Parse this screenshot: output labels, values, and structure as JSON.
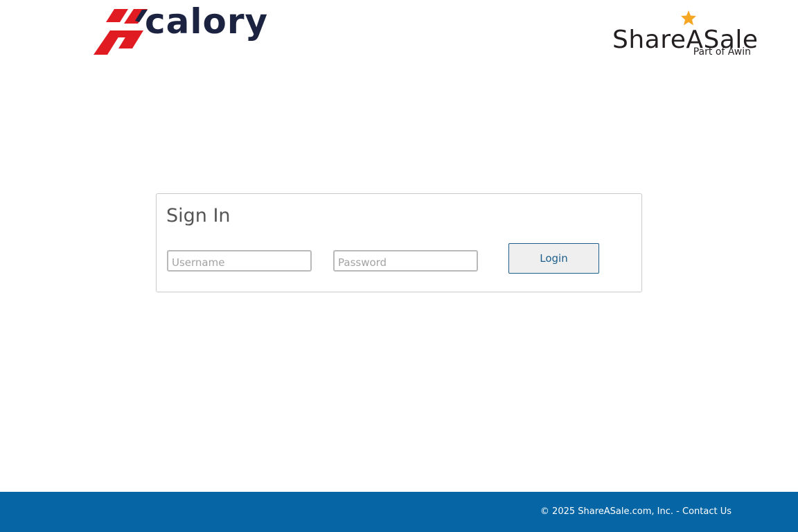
{
  "header": {
    "brand_logo": {
      "text": "calory",
      "icon": "hcalory-h-mark-icon",
      "colors": {
        "red": "#e11b22",
        "navy": "#1b2340"
      }
    },
    "partner_logo": {
      "name": "ShareASale",
      "tagline": "Part of Awin",
      "icon": "star-icon",
      "star_color": "#f5a623"
    }
  },
  "signin": {
    "title": "Sign In",
    "username": {
      "value": "",
      "placeholder": "Username"
    },
    "password": {
      "value": "",
      "placeholder": "Password"
    },
    "login_label": "Login"
  },
  "footer": {
    "copyright": "© 2025 ShareASale.com, Inc.",
    "separator": " - ",
    "contact_label": "Contact Us",
    "background_color": "#0565a5"
  }
}
